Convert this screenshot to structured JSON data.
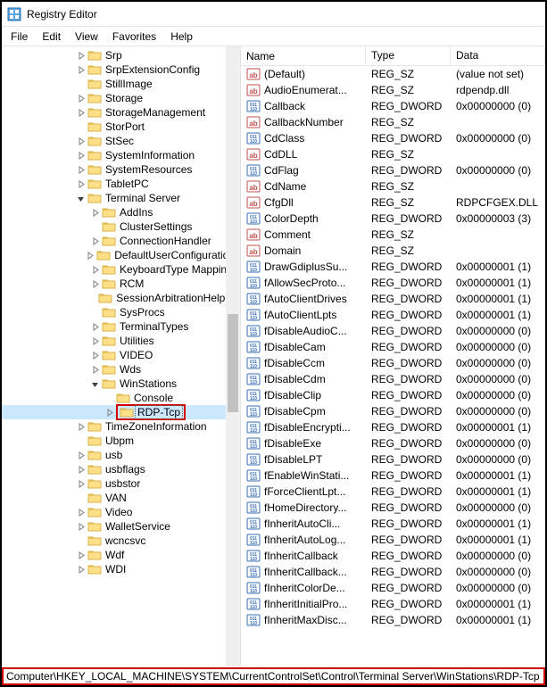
{
  "window": {
    "title": "Registry Editor"
  },
  "menu": {
    "file": "File",
    "edit": "Edit",
    "view": "View",
    "favorites": "Favorites",
    "help": "Help"
  },
  "tree": {
    "nodes": [
      {
        "d": 5,
        "exp": "closed",
        "label": "Srp"
      },
      {
        "d": 5,
        "exp": "closed",
        "label": "SrpExtensionConfig"
      },
      {
        "d": 5,
        "exp": "none",
        "label": "StillImage"
      },
      {
        "d": 5,
        "exp": "closed",
        "label": "Storage"
      },
      {
        "d": 5,
        "exp": "closed",
        "label": "StorageManagement"
      },
      {
        "d": 5,
        "exp": "none",
        "label": "StorPort"
      },
      {
        "d": 5,
        "exp": "closed",
        "label": "StSec"
      },
      {
        "d": 5,
        "exp": "closed",
        "label": "SystemInformation"
      },
      {
        "d": 5,
        "exp": "closed",
        "label": "SystemResources"
      },
      {
        "d": 5,
        "exp": "closed",
        "label": "TabletPC"
      },
      {
        "d": 5,
        "exp": "open",
        "label": "Terminal Server"
      },
      {
        "d": 6,
        "exp": "closed",
        "label": "AddIns"
      },
      {
        "d": 6,
        "exp": "none",
        "label": "ClusterSettings"
      },
      {
        "d": 6,
        "exp": "closed",
        "label": "ConnectionHandler"
      },
      {
        "d": 6,
        "exp": "closed",
        "label": "DefaultUserConfiguration"
      },
      {
        "d": 6,
        "exp": "closed",
        "label": "KeyboardType Mapping"
      },
      {
        "d": 6,
        "exp": "closed",
        "label": "RCM"
      },
      {
        "d": 6,
        "exp": "none",
        "label": "SessionArbitrationHelper"
      },
      {
        "d": 6,
        "exp": "none",
        "label": "SysProcs"
      },
      {
        "d": 6,
        "exp": "closed",
        "label": "TerminalTypes"
      },
      {
        "d": 6,
        "exp": "closed",
        "label": "Utilities"
      },
      {
        "d": 6,
        "exp": "closed",
        "label": "VIDEO"
      },
      {
        "d": 6,
        "exp": "closed",
        "label": "Wds"
      },
      {
        "d": 6,
        "exp": "open",
        "label": "WinStations"
      },
      {
        "d": 7,
        "exp": "none",
        "label": "Console"
      },
      {
        "d": 7,
        "exp": "closed",
        "label": "RDP-Tcp",
        "selected": true,
        "highlighted": true
      },
      {
        "d": 5,
        "exp": "closed",
        "label": "TimeZoneInformation"
      },
      {
        "d": 5,
        "exp": "none",
        "label": "Ubpm"
      },
      {
        "d": 5,
        "exp": "closed",
        "label": "usb"
      },
      {
        "d": 5,
        "exp": "closed",
        "label": "usbflags"
      },
      {
        "d": 5,
        "exp": "closed",
        "label": "usbstor"
      },
      {
        "d": 5,
        "exp": "none",
        "label": "VAN"
      },
      {
        "d": 5,
        "exp": "closed",
        "label": "Video"
      },
      {
        "d": 5,
        "exp": "closed",
        "label": "WalletService"
      },
      {
        "d": 5,
        "exp": "none",
        "label": "wcncsvc"
      },
      {
        "d": 5,
        "exp": "closed",
        "label": "Wdf"
      },
      {
        "d": 5,
        "exp": "closed",
        "label": "WDI"
      }
    ]
  },
  "values": {
    "columns": {
      "name": "Name",
      "type": "Type",
      "data": "Data"
    },
    "rows": [
      {
        "icon": "sz",
        "name": "(Default)",
        "type": "REG_SZ",
        "data": "(value not set)"
      },
      {
        "icon": "sz",
        "name": "AudioEnumerat...",
        "type": "REG_SZ",
        "data": "rdpendp.dll"
      },
      {
        "icon": "dw",
        "name": "Callback",
        "type": "REG_DWORD",
        "data": "0x00000000 (0)"
      },
      {
        "icon": "sz",
        "name": "CallbackNumber",
        "type": "REG_SZ",
        "data": ""
      },
      {
        "icon": "dw",
        "name": "CdClass",
        "type": "REG_DWORD",
        "data": "0x00000000 (0)"
      },
      {
        "icon": "sz",
        "name": "CdDLL",
        "type": "REG_SZ",
        "data": ""
      },
      {
        "icon": "dw",
        "name": "CdFlag",
        "type": "REG_DWORD",
        "data": "0x00000000 (0)"
      },
      {
        "icon": "sz",
        "name": "CdName",
        "type": "REG_SZ",
        "data": ""
      },
      {
        "icon": "sz",
        "name": "CfgDll",
        "type": "REG_SZ",
        "data": "RDPCFGEX.DLL"
      },
      {
        "icon": "dw",
        "name": "ColorDepth",
        "type": "REG_DWORD",
        "data": "0x00000003 (3)"
      },
      {
        "icon": "sz",
        "name": "Comment",
        "type": "REG_SZ",
        "data": ""
      },
      {
        "icon": "sz",
        "name": "Domain",
        "type": "REG_SZ",
        "data": ""
      },
      {
        "icon": "dw",
        "name": "DrawGdiplusSu...",
        "type": "REG_DWORD",
        "data": "0x00000001 (1)"
      },
      {
        "icon": "dw",
        "name": "fAllowSecProto...",
        "type": "REG_DWORD",
        "data": "0x00000001 (1)"
      },
      {
        "icon": "dw",
        "name": "fAutoClientDrives",
        "type": "REG_DWORD",
        "data": "0x00000001 (1)"
      },
      {
        "icon": "dw",
        "name": "fAutoClientLpts",
        "type": "REG_DWORD",
        "data": "0x00000001 (1)"
      },
      {
        "icon": "dw",
        "name": "fDisableAudioC...",
        "type": "REG_DWORD",
        "data": "0x00000000 (0)"
      },
      {
        "icon": "dw",
        "name": "fDisableCam",
        "type": "REG_DWORD",
        "data": "0x00000000 (0)"
      },
      {
        "icon": "dw",
        "name": "fDisableCcm",
        "type": "REG_DWORD",
        "data": "0x00000000 (0)"
      },
      {
        "icon": "dw",
        "name": "fDisableCdm",
        "type": "REG_DWORD",
        "data": "0x00000000 (0)"
      },
      {
        "icon": "dw",
        "name": "fDisableClip",
        "type": "REG_DWORD",
        "data": "0x00000000 (0)"
      },
      {
        "icon": "dw",
        "name": "fDisableCpm",
        "type": "REG_DWORD",
        "data": "0x00000000 (0)"
      },
      {
        "icon": "dw",
        "name": "fDisableEncrypti...",
        "type": "REG_DWORD",
        "data": "0x00000001 (1)"
      },
      {
        "icon": "dw",
        "name": "fDisableExe",
        "type": "REG_DWORD",
        "data": "0x00000000 (0)"
      },
      {
        "icon": "dw",
        "name": "fDisableLPT",
        "type": "REG_DWORD",
        "data": "0x00000000 (0)"
      },
      {
        "icon": "dw",
        "name": "fEnableWinStati...",
        "type": "REG_DWORD",
        "data": "0x00000001 (1)"
      },
      {
        "icon": "dw",
        "name": "fForceClientLpt...",
        "type": "REG_DWORD",
        "data": "0x00000001 (1)"
      },
      {
        "icon": "dw",
        "name": "fHomeDirectory...",
        "type": "REG_DWORD",
        "data": "0x00000000 (0)"
      },
      {
        "icon": "dw",
        "name": "fInheritAutoCli...",
        "type": "REG_DWORD",
        "data": "0x00000001 (1)"
      },
      {
        "icon": "dw",
        "name": "fInheritAutoLog...",
        "type": "REG_DWORD",
        "data": "0x00000001 (1)"
      },
      {
        "icon": "dw",
        "name": "fInheritCallback",
        "type": "REG_DWORD",
        "data": "0x00000000 (0)"
      },
      {
        "icon": "dw",
        "name": "fInheritCallback...",
        "type": "REG_DWORD",
        "data": "0x00000000 (0)"
      },
      {
        "icon": "dw",
        "name": "fInheritColorDe...",
        "type": "REG_DWORD",
        "data": "0x00000000 (0)"
      },
      {
        "icon": "dw",
        "name": "fInheritInitialPro...",
        "type": "REG_DWORD",
        "data": "0x00000001 (1)"
      },
      {
        "icon": "dw",
        "name": "fInheritMaxDisc...",
        "type": "REG_DWORD",
        "data": "0x00000001 (1)"
      }
    ]
  },
  "statusbar": {
    "path": "Computer\\HKEY_LOCAL_MACHINE\\SYSTEM\\CurrentControlSet\\Control\\Terminal Server\\WinStations\\RDP-Tcp"
  }
}
